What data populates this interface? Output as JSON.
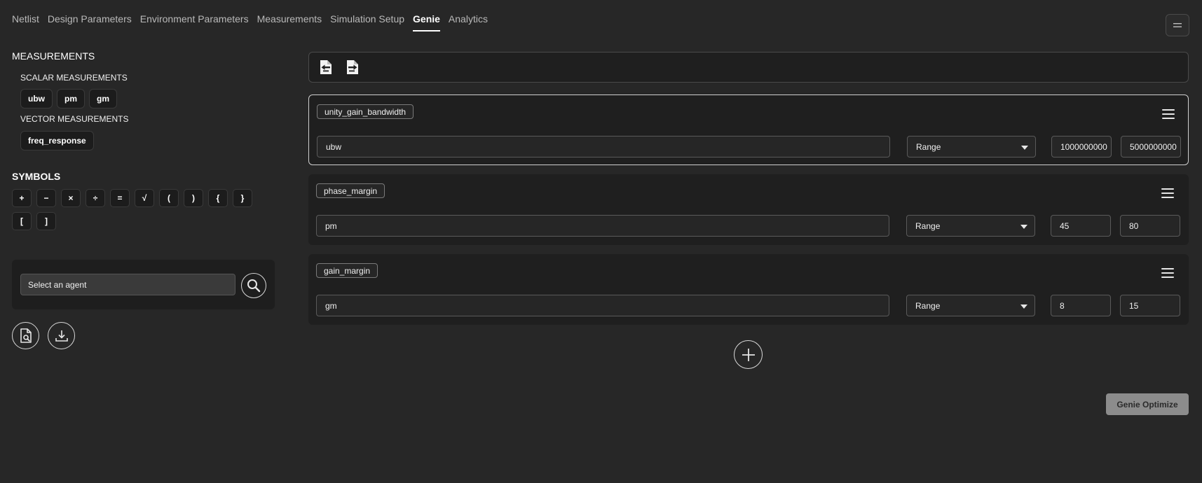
{
  "nav": {
    "tabs": [
      {
        "label": "Netlist",
        "active": false
      },
      {
        "label": "Design Parameters",
        "active": false
      },
      {
        "label": "Environment Parameters",
        "active": false
      },
      {
        "label": "Measurements",
        "active": false
      },
      {
        "label": "Simulation Setup",
        "active": false
      },
      {
        "label": "Genie",
        "active": true
      },
      {
        "label": "Analytics",
        "active": false
      }
    ],
    "menu_icon": "hamburger-icon"
  },
  "left": {
    "measurements_title": "MEASUREMENTS",
    "scalar_title": "SCALAR MEASUREMENTS",
    "scalar_items": [
      "ubw",
      "pm",
      "gm"
    ],
    "vector_title": "VECTOR MEASUREMENTS",
    "vector_items": [
      "freq_response"
    ],
    "symbols_title": "SYMBOLS",
    "symbols": [
      "+",
      "−",
      "×",
      "÷",
      "=",
      "√",
      "(",
      ")",
      "{",
      "}",
      "[",
      "]"
    ],
    "agent": {
      "placeholder": "Select an agent",
      "search_icon": "search-icon"
    },
    "actions": {
      "inspect_icon": "file-search-icon",
      "download_icon": "download-icon"
    }
  },
  "toolbar": {
    "import_icon": "file-import-icon",
    "export_icon": "file-export-icon"
  },
  "specs": [
    {
      "name": "unity_gain_bandwidth",
      "expression": "ubw",
      "mode": "Range",
      "min": "1000000000",
      "max": "5000000000",
      "selected": true
    },
    {
      "name": "phase_margin",
      "expression": "pm",
      "mode": "Range",
      "min": "45",
      "max": "80",
      "selected": false
    },
    {
      "name": "gain_margin",
      "expression": "gm",
      "mode": "Range",
      "min": "8",
      "max": "15",
      "selected": false
    }
  ],
  "add_icon": "plus-icon",
  "optimize_label": "Genie Optimize"
}
